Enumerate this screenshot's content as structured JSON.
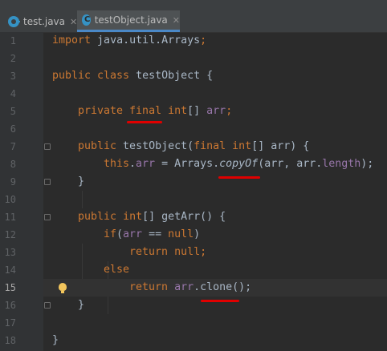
{
  "tabs": [
    {
      "label": "test.java",
      "close": "✕"
    },
    {
      "label": "testObject.java",
      "close": "✕",
      "icon_letter": "C"
    }
  ],
  "lines": [
    {
      "num": "1"
    },
    {
      "num": "2"
    },
    {
      "num": "3"
    },
    {
      "num": "4"
    },
    {
      "num": "5"
    },
    {
      "num": "6"
    },
    {
      "num": "7"
    },
    {
      "num": "8"
    },
    {
      "num": "9"
    },
    {
      "num": "10"
    },
    {
      "num": "11"
    },
    {
      "num": "12"
    },
    {
      "num": "13"
    },
    {
      "num": "14"
    },
    {
      "num": "15"
    },
    {
      "num": "16"
    },
    {
      "num": "17"
    },
    {
      "num": "18"
    }
  ],
  "code": {
    "l1": [
      "import",
      " java.util.Arrays",
      ";"
    ],
    "l3": [
      "public class",
      " testObject ",
      "{"
    ],
    "l5": [
      "private ",
      "final",
      " ",
      "int",
      "[] ",
      "arr",
      ";"
    ],
    "l7": [
      "public",
      " testObject(",
      "final",
      " ",
      "int",
      "[] arr) {"
    ],
    "l8": [
      "this",
      ".",
      "arr",
      " = Arrays.",
      "copyOf",
      "(arr, arr.",
      "length",
      ");"
    ],
    "l9": [
      "}"
    ],
    "l11": [
      "public",
      " ",
      "int",
      "[] getArr() {"
    ],
    "l12": [
      "if",
      "(",
      "arr",
      " == ",
      "null",
      ")"
    ],
    "l13": [
      "return",
      " ",
      "null",
      ";"
    ],
    "l14": [
      "else"
    ],
    "l15": [
      "return",
      " ",
      "arr",
      ".clone();"
    ],
    "l16": [
      "}"
    ],
    "l18": [
      "}"
    ]
  },
  "colors": {
    "background": "#2b2b2b",
    "keyword": "#cc7832",
    "field": "#9876aa",
    "text": "#a9b7c6",
    "annotation_underline": "#e00000"
  },
  "current_line": "15"
}
